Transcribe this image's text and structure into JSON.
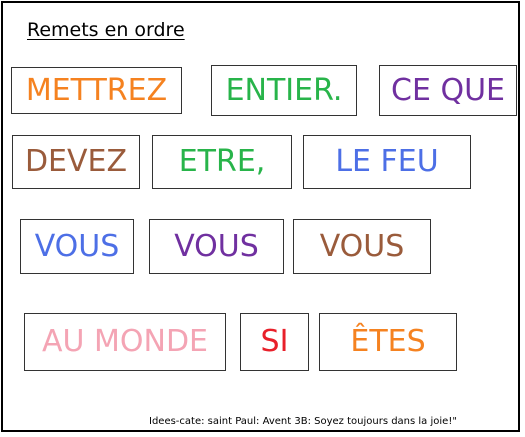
{
  "title": "Remets en ordre",
  "cards": [
    {
      "text": "METTREZ",
      "color": "#f58220"
    },
    {
      "text": "ENTIER.",
      "color": "#28b44a"
    },
    {
      "text": "CE QUE",
      "color": "#7030a0"
    },
    {
      "text": "DEVEZ",
      "color": "#9a5b3b"
    },
    {
      "text": "ETRE,",
      "color": "#28b44a"
    },
    {
      "text": "LE FEU",
      "color": "#4d6fe6"
    },
    {
      "text": "VOUS",
      "color": "#4d6fe6"
    },
    {
      "text": "VOUS",
      "color": "#7030a0"
    },
    {
      "text": "VOUS",
      "color": "#9a5b3b"
    },
    {
      "text": "AU MONDE",
      "color": "#f4a4b4"
    },
    {
      "text": "SI",
      "color": "#e8202a"
    },
    {
      "text": "ÊTES",
      "color": "#f58220"
    }
  ],
  "footer": "Idees-cate: saint Paul: Avent 3B: Soyez toujours dans la joie!\""
}
